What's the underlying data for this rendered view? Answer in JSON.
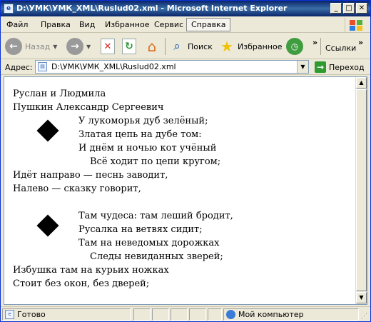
{
  "window": {
    "title": "D:\\УМК\\УМК_XML\\Ruslud02.xml - Microsoft Internet Explorer"
  },
  "menu": [
    "Файл",
    "Правка",
    "Вид",
    "Избранное",
    "Сервис",
    "Справка"
  ],
  "toolbar": {
    "back": "Назад",
    "search": "Поиск",
    "favorites": "Избранное",
    "more": "»",
    "links": "Ссылки"
  },
  "address": {
    "label": "Адрес:",
    "value": "D:\\УМК\\УМК_XML\\Ruslud02.xml",
    "go": "Переход"
  },
  "document": {
    "title": "Руслан и Людмила",
    "author": "Пушкин Александр Сергеевич",
    "stanza1": [
      "У лукоморья дуб зелёный;",
      "Златая цепь на дубе том:",
      "И днём и ночью кот учёный",
      "Всё ходит по цепи кругом;"
    ],
    "tail1": [
      "Идёт направо — песнь заводит,",
      "Налево — сказку говорит,"
    ],
    "stanza2": [
      "Там чудеса: там леший бродит,",
      "Русалка на ветвях сидит;",
      "Там на неведомых дорожках",
      "Следы невиданных зверей;"
    ],
    "tail2": [
      "Избушка там на курьих ножках",
      "Стоит без окон, без дверей;"
    ]
  },
  "status": {
    "text": "Готово",
    "zone": "Мой компьютер"
  },
  "colors": {
    "titlebar": "#0a246a",
    "chrome": "#ece9d8"
  }
}
